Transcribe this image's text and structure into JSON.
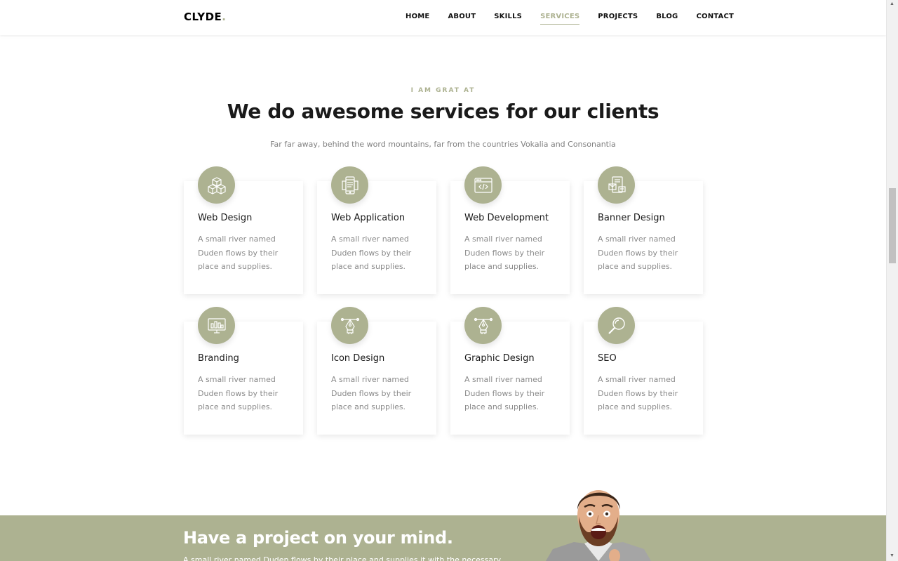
{
  "navbar": {
    "brand": "CLYDE",
    "brand_dot": ".",
    "items": [
      {
        "label": "HOME",
        "active": false
      },
      {
        "label": "ABOUT",
        "active": false
      },
      {
        "label": "SKILLS",
        "active": false
      },
      {
        "label": "SERVICES",
        "active": true
      },
      {
        "label": "PROJECTS",
        "active": false
      },
      {
        "label": "BLOG",
        "active": false
      },
      {
        "label": "CONTACT",
        "active": false
      }
    ]
  },
  "services": {
    "eyebrow": "I AM GRAT AT",
    "heading": "We do awesome services for our clients",
    "subheading": "Far far away, behind the word mountains, far from the countries Vokalia and Consonantia",
    "cards": [
      {
        "title": "Web Design",
        "desc": "A small river named Duden flows by their place and supplies.",
        "icon": "cubes-icon"
      },
      {
        "title": "Web Application",
        "desc": "A small river named Duden flows by their place and supplies.",
        "icon": "mobile-app-icon"
      },
      {
        "title": "Web Development",
        "desc": "A small river named Duden flows by their place and supplies.",
        "icon": "code-window-icon"
      },
      {
        "title": "Banner Design",
        "desc": "A small river named Duden flows by their place and supplies.",
        "icon": "banner-icon"
      },
      {
        "title": "Branding",
        "desc": "A small river named Duden flows by their place and supplies.",
        "icon": "monitor-chart-icon"
      },
      {
        "title": "Icon Design",
        "desc": "A small river named Duden flows by their place and supplies.",
        "icon": "pen-tool-icon"
      },
      {
        "title": "Graphic Design",
        "desc": "A small river named Duden flows by their place and supplies.",
        "icon": "pen-tool-icon"
      },
      {
        "title": "SEO",
        "desc": "A small river named Duden flows by their place and supplies.",
        "icon": "magnifier-icon"
      }
    ]
  },
  "cta": {
    "title": "Have a project on your mind.",
    "text": "A small river named Duden flows by their place and supplies it with the necessary"
  },
  "colors": {
    "accent": "#adb291",
    "heading": "#1a1a1a",
    "muted": "#808080"
  }
}
